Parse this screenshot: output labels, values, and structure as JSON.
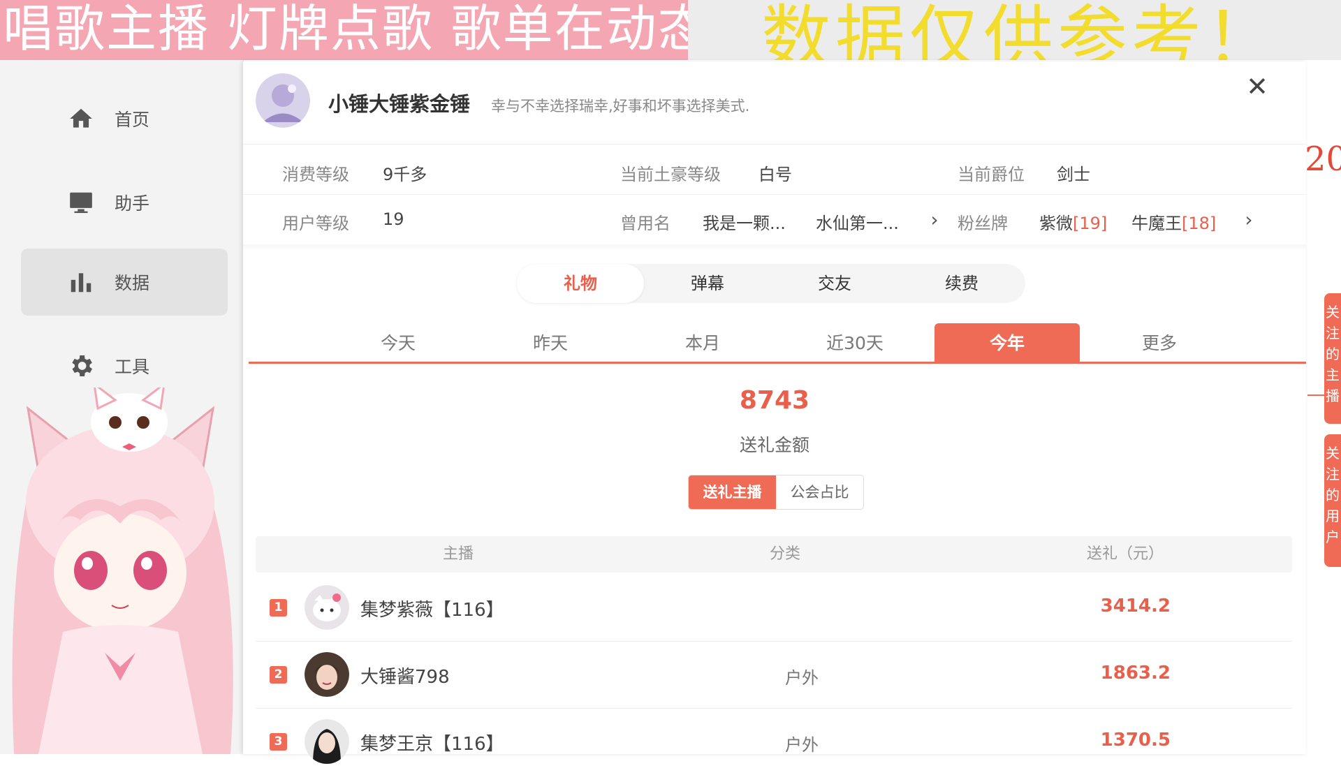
{
  "banner": {
    "left_text": "唱歌主播 灯牌点歌 歌单在动态",
    "right_text": "数据仅供参考！",
    "left_bg": "#f4a7b3",
    "right_color": "#f2dc2e"
  },
  "sidebar": {
    "items": [
      {
        "label": "首页",
        "icon": "home-icon"
      },
      {
        "label": "助手",
        "icon": "monitor-icon"
      },
      {
        "label": "数据",
        "icon": "bar-chart-icon",
        "active": true
      },
      {
        "label": "工具",
        "icon": "gear-icon"
      }
    ]
  },
  "dialog": {
    "user": {
      "name": "小锤大锤紫金锤",
      "signature": "幸与不幸选择瑞幸,好事和坏事选择美式."
    },
    "info": {
      "consume_level_label": "消费等级",
      "consume_level_value": "9千多",
      "tycoon_label": "当前土豪等级",
      "tycoon_value": "白号",
      "title_label": "当前爵位",
      "title_value": "剑士",
      "user_level_label": "用户等级",
      "user_level_value": "19",
      "alias_label": "曾用名",
      "alias_1": "我是一颗...",
      "alias_2": "水仙第一...",
      "fan_badge_label": "粉丝牌",
      "badge_1_name": "紫微",
      "badge_1_level": "[19]",
      "badge_2_name": "牛魔王",
      "badge_2_level": "[18]"
    },
    "category_tabs": [
      "礼物",
      "弹幕",
      "交友",
      "续费"
    ],
    "active_category": "礼物",
    "time_tabs": [
      "今天",
      "昨天",
      "本月",
      "近30天",
      "今年",
      "更多"
    ],
    "active_time": "今年",
    "total": {
      "value": "8743",
      "label": "送礼金额"
    },
    "segment": {
      "option_1": "送礼主播",
      "option_2": "公会占比",
      "active": "送礼主播"
    },
    "table": {
      "columns": [
        "主播",
        "分类",
        "送礼（元）"
      ],
      "rows": [
        {
          "rank": "1",
          "name": "集梦紫薇【116】",
          "category": "",
          "amount": "3414.2"
        },
        {
          "rank": "2",
          "name": "大锤酱798",
          "category": "户外",
          "amount": "1863.2"
        },
        {
          "rank": "3",
          "name": "集梦王京【116】",
          "category": "户外",
          "amount": "1370.5"
        }
      ]
    }
  },
  "right_peek": {
    "number": "20",
    "tab_1": "关注的主播",
    "tab_2": "关注的用户"
  },
  "colors": {
    "accent": "#f06b55",
    "accent_text": "#e8604c"
  }
}
